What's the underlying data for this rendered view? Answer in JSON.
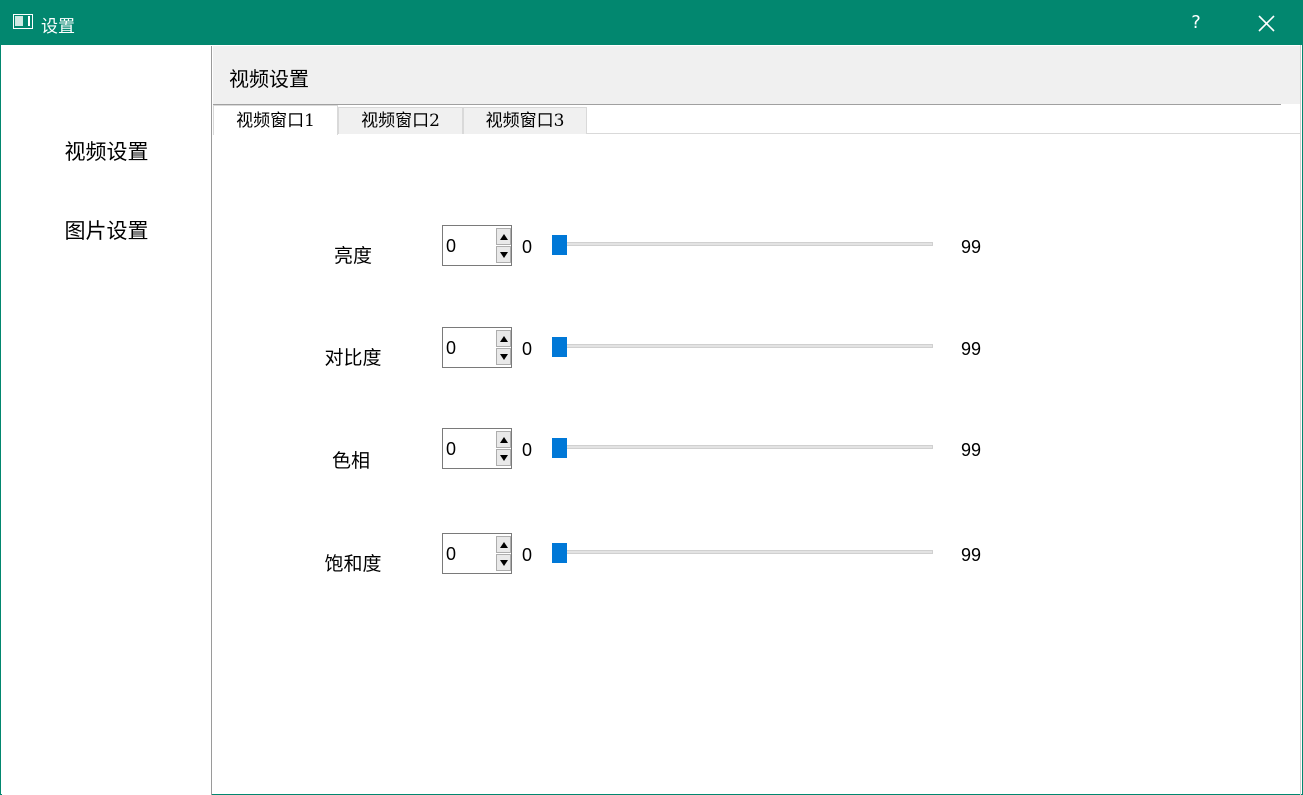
{
  "window": {
    "title": "设置",
    "help_label": "?",
    "accent_color": "#02876f"
  },
  "sidebar": {
    "items": [
      {
        "label": "视频设置"
      },
      {
        "label": "图片设置"
      }
    ]
  },
  "main": {
    "section_title": "视频设置",
    "tabs": [
      {
        "label": "视频窗口1",
        "active": true
      },
      {
        "label": "视频窗口2",
        "active": false
      },
      {
        "label": "视频窗口3",
        "active": false
      }
    ],
    "controls": [
      {
        "label": "亮度",
        "spin_value": "0",
        "slider_value": "0",
        "slider_max": "99"
      },
      {
        "label": "对比度",
        "spin_value": "0",
        "slider_value": "0",
        "slider_max": "99"
      },
      {
        "label": "色相",
        "spin_value": "0",
        "slider_value": "0",
        "slider_max": "99"
      },
      {
        "label": "饱和度",
        "spin_value": "0",
        "slider_value": "0",
        "slider_max": "99"
      }
    ],
    "slider_color": "#0078d7"
  }
}
